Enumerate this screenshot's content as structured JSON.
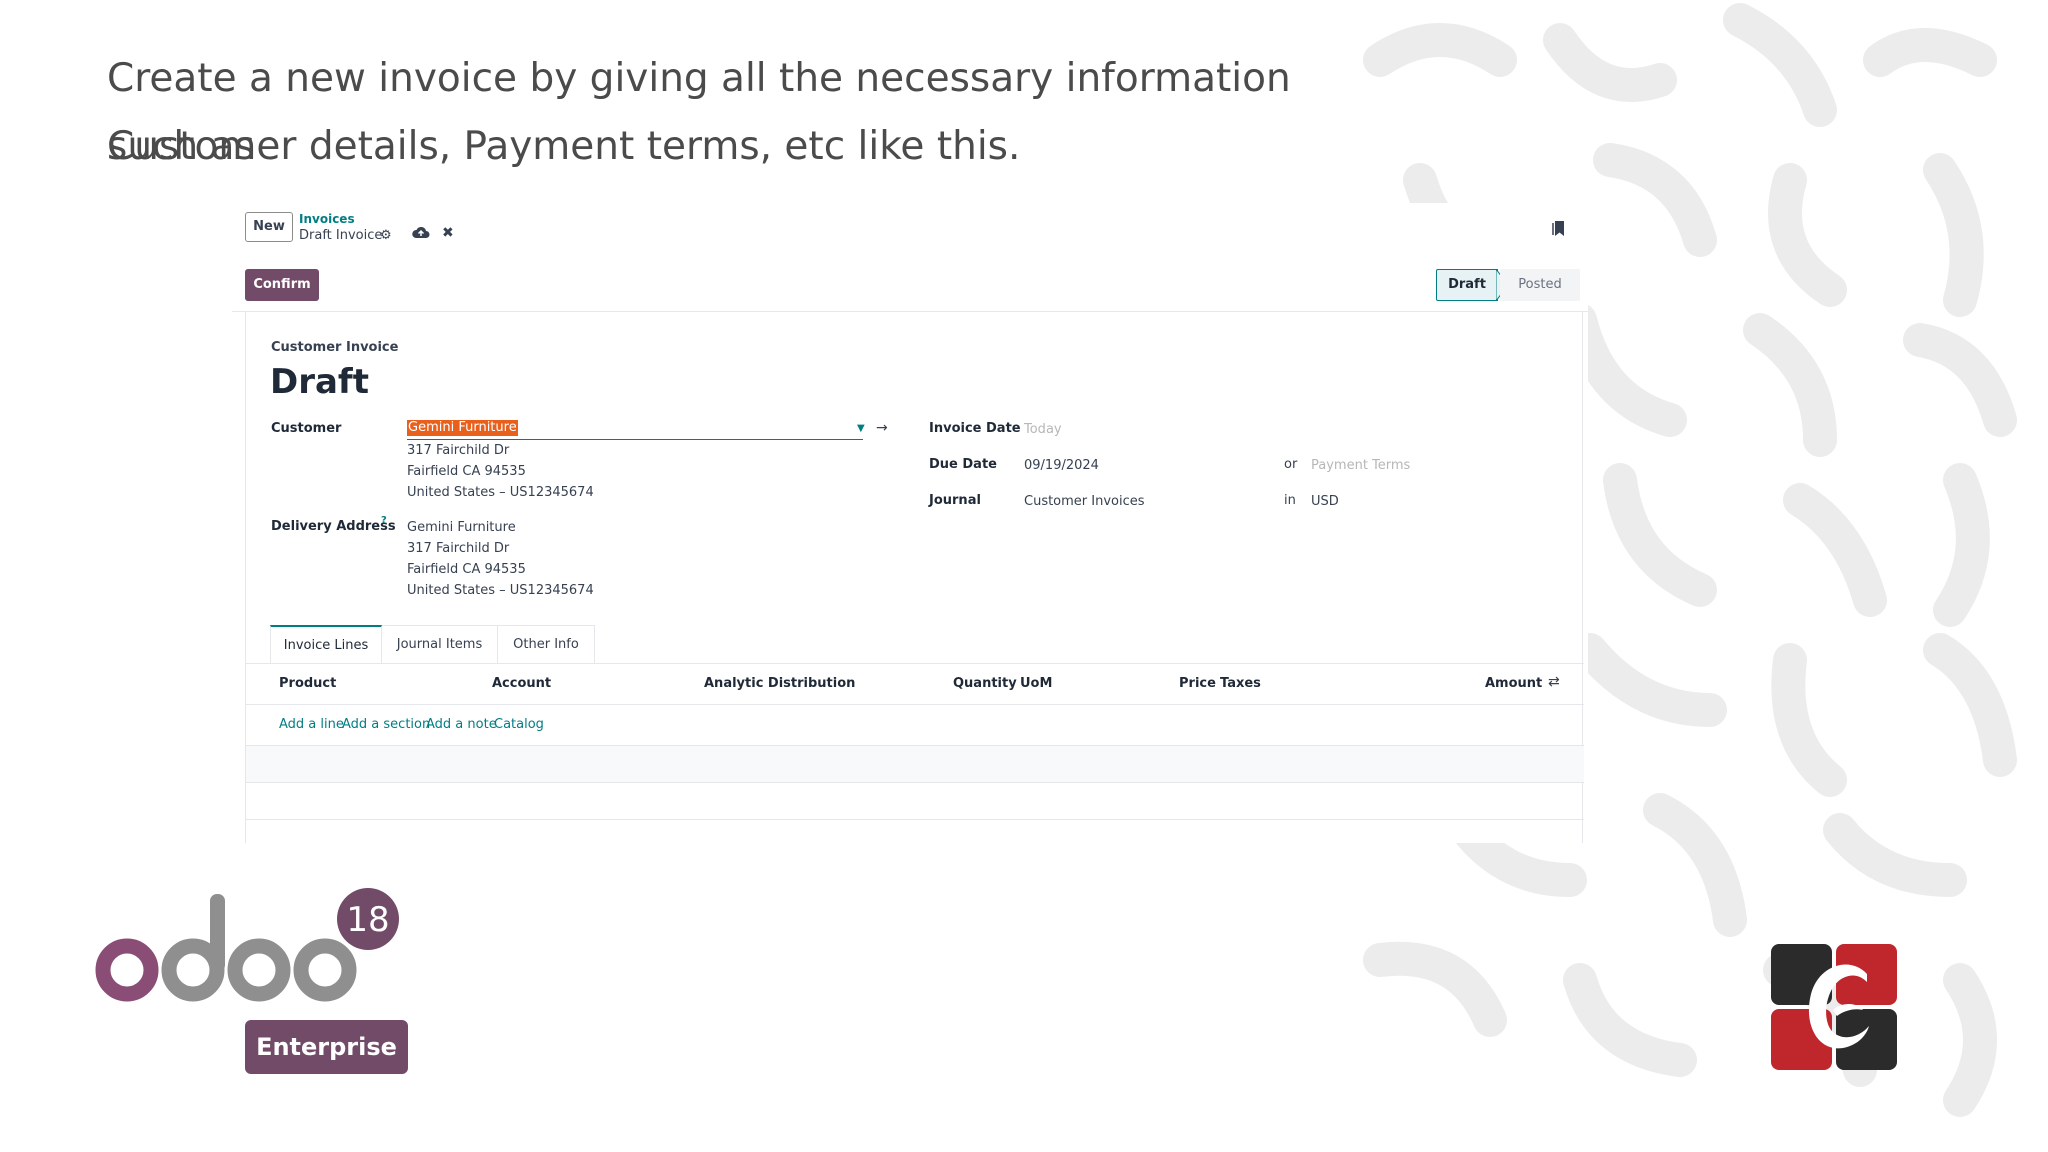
{
  "slide": {
    "line1": "Create a new invoice by giving all the necessary information such as",
    "line2": "Customer details, Payment terms, etc like this."
  },
  "control_panel": {
    "new_label": "New",
    "breadcrumb_parent": "Invoices",
    "breadcrumb_current": "Draft Invoice"
  },
  "status_bar": {
    "confirm_label": "Confirm",
    "stages": [
      "Draft",
      "Posted"
    ],
    "active_stage": "Draft"
  },
  "form": {
    "move_type": "Customer Invoice",
    "title": "Draft",
    "customer_label": "Customer",
    "customer_value": "Gemini Furniture",
    "customer_address": [
      "317 Fairchild Dr",
      "Fairfield CA 94535",
      "United States – US12345674"
    ],
    "delivery_label": "Delivery Address",
    "delivery_help": "?",
    "delivery_address": [
      "Gemini Furniture",
      "317 Fairchild Dr",
      "Fairfield CA 94535",
      "United States – US12345674"
    ],
    "invoice_date_label": "Invoice Date",
    "invoice_date_placeholder": "Today",
    "due_date_label": "Due Date",
    "due_date_value": "09/19/2024",
    "or_label": "or",
    "payment_terms_placeholder": "Payment Terms",
    "journal_label": "Journal",
    "journal_value": "Customer Invoices",
    "in_label": "in",
    "currency_value": "USD"
  },
  "tabs": [
    "Invoice Lines",
    "Journal Items",
    "Other Info"
  ],
  "lines": {
    "columns": [
      "Product",
      "Account",
      "Analytic Distribution",
      "Quantity",
      "UoM",
      "Price",
      "Taxes",
      "Amount"
    ],
    "actions": [
      "Add a line",
      "Add a section",
      "Add a note",
      "Catalog"
    ]
  },
  "branding": {
    "odoo_text": "odoo",
    "version": "18",
    "edition": "Enterprise",
    "brand_color": "#714b67",
    "accent_color": "#017e84",
    "highlight_color": "#e8601c"
  }
}
